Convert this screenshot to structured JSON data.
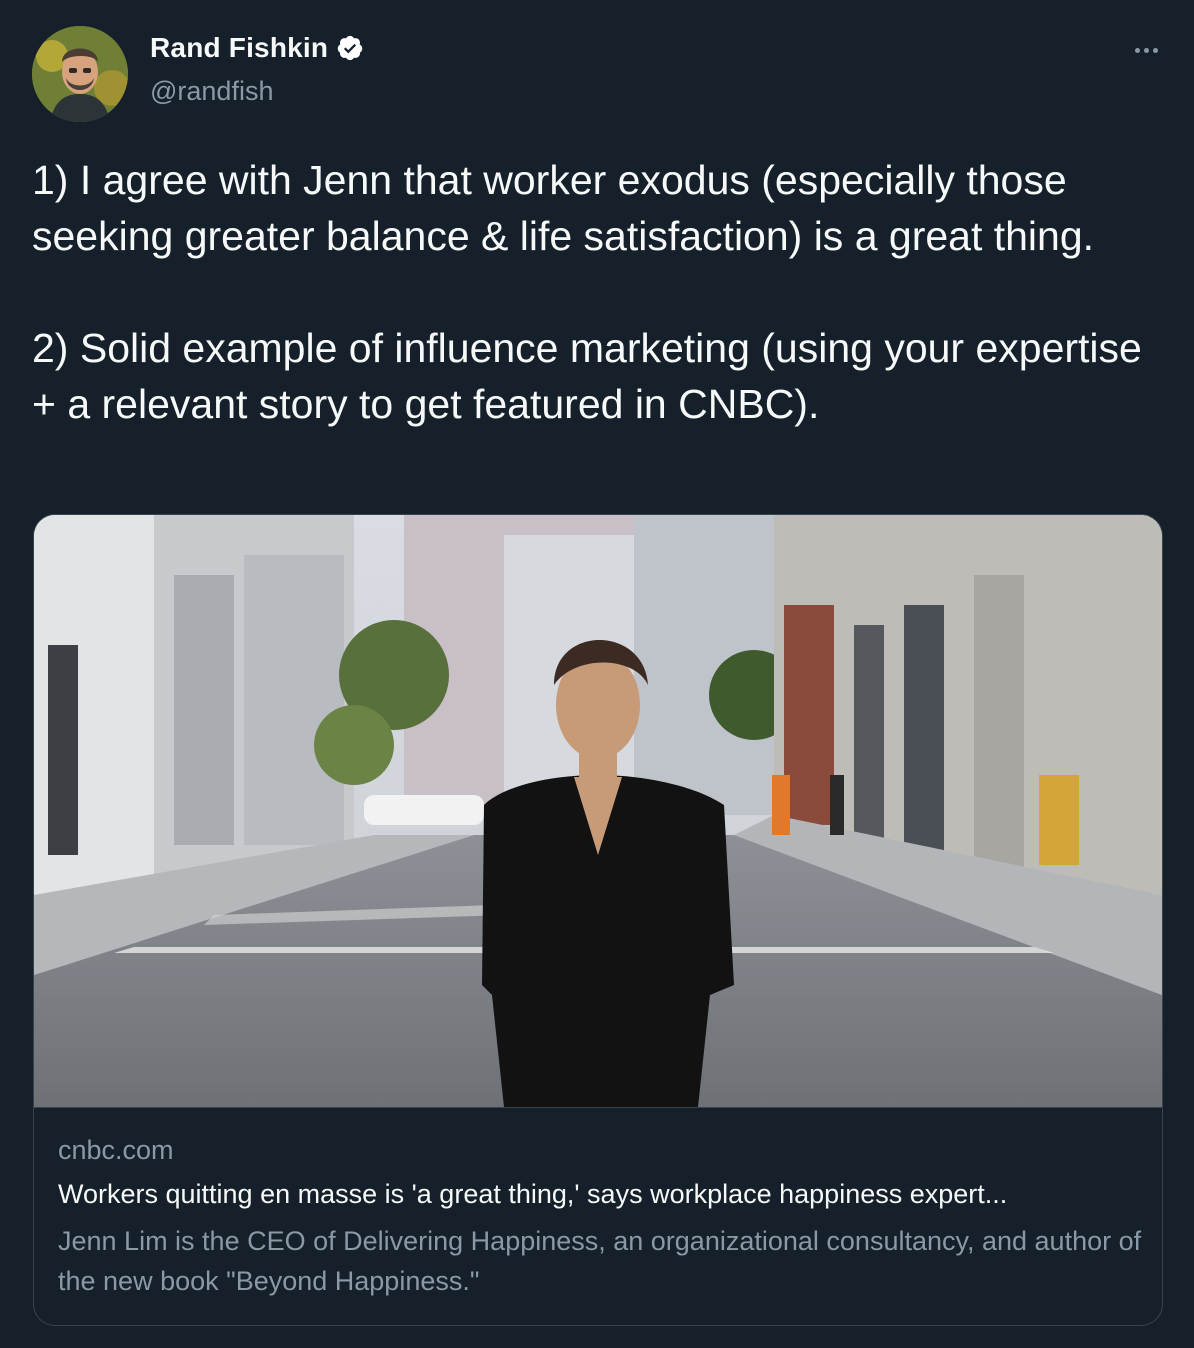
{
  "author": {
    "display_name": "Rand Fishkin",
    "handle": "@randfish",
    "verified": true
  },
  "tweet": {
    "paragraphs": [
      "1) I agree with Jenn that worker exodus (especially those seeking greater balance & life satisfaction) is a great thing.",
      "2) Solid example of influence marketing (using your expertise + a relevant story to get featured in CNBC)."
    ]
  },
  "card": {
    "domain": "cnbc.com",
    "title": "Workers quitting en masse is 'a great thing,' says workplace happiness expert...",
    "description": "Jenn Lim is the CEO of Delivering Happiness, an organizational consultancy, and author of the new book \"Beyond Happiness.\""
  },
  "colors": {
    "background": "#15202b",
    "text": "#f7f9f9",
    "secondary_text": "#8b98a5",
    "border": "#38444d",
    "verified_badge": "#ffffff"
  },
  "icons": {
    "verified": "verified-badge-icon",
    "more": "more-options-icon"
  }
}
